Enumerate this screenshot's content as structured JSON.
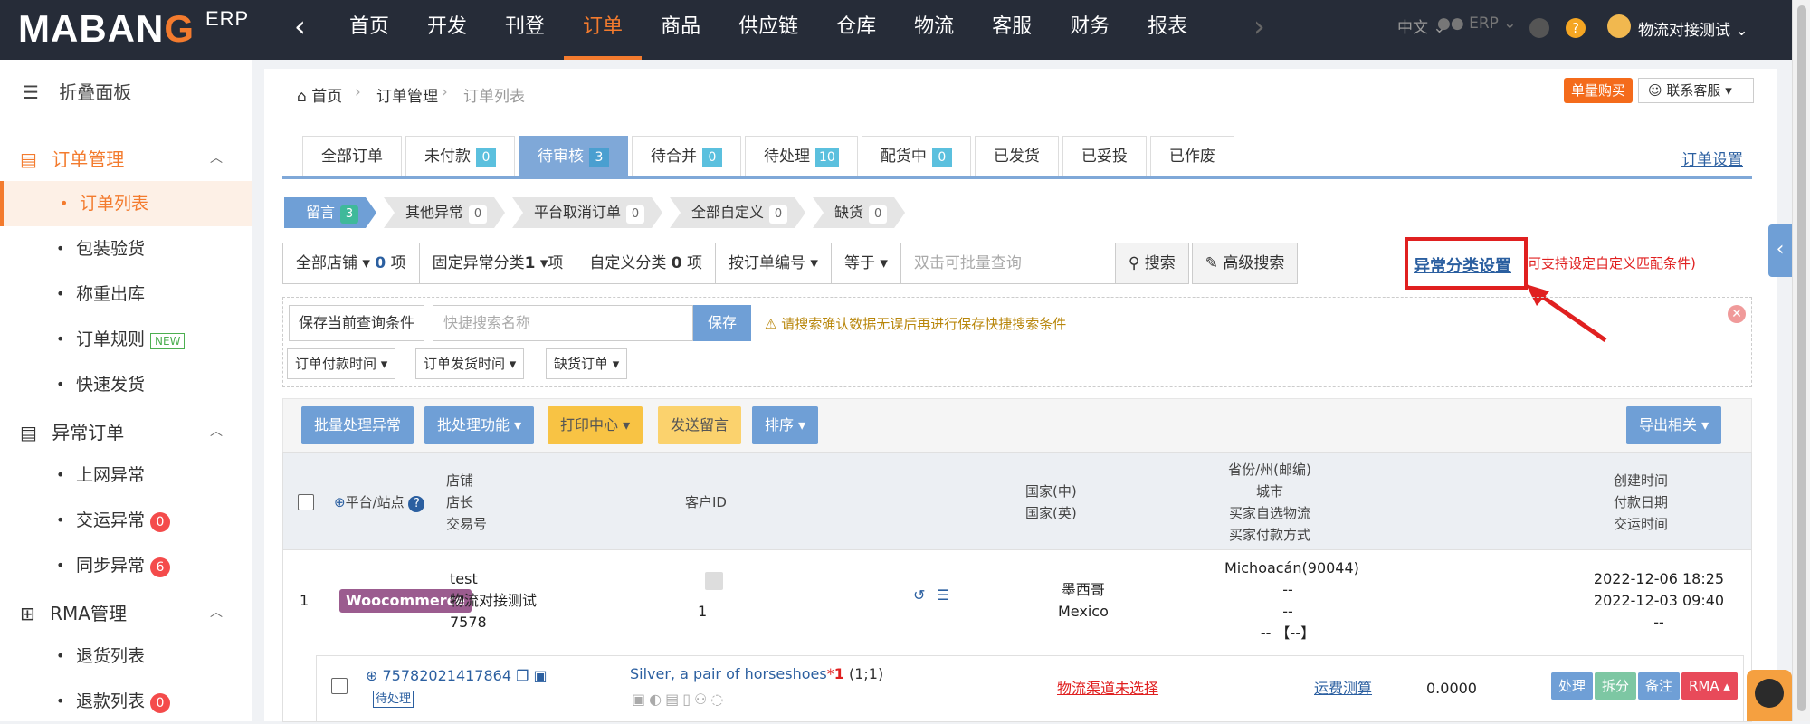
{
  "topbar": {
    "logo_text": "MABAN",
    "logo_o": "G",
    "logo_sup": "ERP",
    "nav": [
      "首页",
      "开发",
      "刊登",
      "订单",
      "商品",
      "供应链",
      "仓库",
      "物流",
      "客服",
      "财务",
      "报表"
    ],
    "active_nav": "订单",
    "lang": "中文",
    "erp": "ERP",
    "user": "物流对接测试"
  },
  "sidebar": {
    "collapse": "折叠面板",
    "groups": [
      {
        "label": "订单管理",
        "items": [
          "订单列表",
          "包装验货",
          "称重出库",
          "订单规则",
          "快速发货"
        ],
        "active": "订单列表",
        "new_badge": "NEW"
      },
      {
        "label": "异常订单",
        "items": [
          "上网异常",
          "交运异常",
          "同步异常"
        ],
        "badges": [
          "0",
          "6"
        ]
      },
      {
        "label": "RMA管理",
        "items": [
          "退货列表",
          "退款列表"
        ],
        "badges": [
          "0"
        ]
      }
    ]
  },
  "breadcrumb": {
    "home": "首页",
    "b2": "订单管理",
    "b3": "订单列表"
  },
  "header_actions": {
    "buy": "单量购买",
    "service": "联系客服"
  },
  "tabs": [
    {
      "label": "全部订单",
      "count": null
    },
    {
      "label": "未付款",
      "count": "0"
    },
    {
      "label": "待审核",
      "count": "3",
      "active": true
    },
    {
      "label": "待合并",
      "count": "0"
    },
    {
      "label": "待处理",
      "count": "10"
    },
    {
      "label": "配货中",
      "count": "0"
    },
    {
      "label": "已发货",
      "count": null
    },
    {
      "label": "已妥投",
      "count": null
    },
    {
      "label": "已作废",
      "count": null
    }
  ],
  "order_settings": "订单设置",
  "chips": [
    {
      "label": "留言",
      "count": "3",
      "active": true
    },
    {
      "label": "其他异常",
      "count": "0"
    },
    {
      "label": "平台取消订单",
      "count": "0"
    },
    {
      "label": "全部自定义",
      "count": "0"
    },
    {
      "label": "缺货",
      "count": "0"
    }
  ],
  "filters": {
    "all_shops": "全部店铺",
    "all_shops_count": "0",
    "all_shops_unit": "项",
    "fixed_cat": "固定异常分类",
    "fixed_cat_count": "1",
    "fixed_cat_unit": "项",
    "custom_cat": "自定义分类",
    "custom_cat_count": "0",
    "custom_cat_unit": "项",
    "by_order": "按订单编号",
    "equals": "等于",
    "search_placeholder": "双击可批量查询",
    "search": "搜索",
    "advanced": "高级搜索",
    "anomaly_setting": "异常分类设置",
    "anomaly_note": "可支持设定自定义匹配条件)"
  },
  "savebar": {
    "save_cond": "保存当前查询条件",
    "quick_name_placeholder": "快捷搜索名称",
    "save": "保存",
    "warning": "请搜索确认数据无误后再进行保存快捷搜索条件",
    "sel1": "订单付款时间",
    "sel2": "订单发货时间",
    "sel3": "缺货订单"
  },
  "actions": {
    "batch_anomaly": "批量处理异常",
    "batch_func": "批处理功能",
    "print": "打印中心",
    "send_msg": "发送留言",
    "sort": "排序",
    "export": "导出相关"
  },
  "table_head": {
    "platform": "平台/站点",
    "shop": "店铺",
    "owner": "店长",
    "txn": "交易号",
    "customer": "客户ID",
    "country_cn": "国家(中)",
    "country_en": "国家(英)",
    "province": "省份/州(邮编)",
    "city": "城市",
    "buyer_logistics": "买家自选物流",
    "buyer_pay": "买家付款方式",
    "created": "创建时间",
    "paid": "付款日期",
    "shipped": "交运时间"
  },
  "row": {
    "index": "1",
    "platform": "Woocommerce",
    "shop": "test",
    "owner": "物流对接测试",
    "txn": "7578",
    "customer": "1",
    "country_cn": "墨西哥",
    "country_en": "Mexico",
    "province": "Michoacán(90044)",
    "city": "--",
    "buyer_logistics": "--",
    "buyer_pay": "-- 【--】",
    "created": "2022-12-06 18:25",
    "paid": "2022-12-03 09:40",
    "shipped": "--",
    "order_no": "75782021417864",
    "status": "待处理",
    "product": "Silver, a pair of horseshoes",
    "qty_mark": "*",
    "qty": "1",
    "qty_detail": "(1;1)",
    "channel": "物流渠道未选择",
    "freight": "运费测算",
    "amount": "0.0000",
    "btn_process": "处理",
    "btn_split": "拆分",
    "btn_note": "备注",
    "btn_rma": "RMA"
  },
  "colors": {
    "accent": "#f37b2e",
    "primary": "#6f9fd6",
    "danger": "#e02020"
  }
}
